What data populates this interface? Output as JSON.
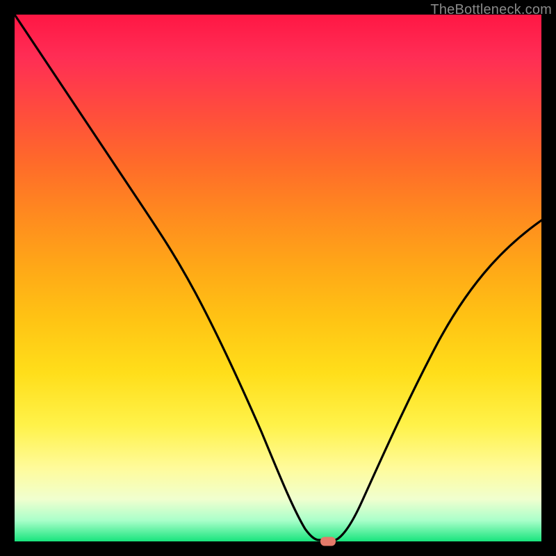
{
  "watermark": "TheBottleneck.com",
  "chart_data": {
    "type": "line",
    "title": "",
    "xlabel": "",
    "ylabel": "",
    "xlim": [
      0,
      100
    ],
    "ylim": [
      0,
      100
    ],
    "x": [
      0,
      8,
      16,
      24,
      29,
      34,
      39,
      44,
      48,
      52,
      55,
      57,
      59,
      61,
      64,
      68,
      73,
      80,
      88,
      96,
      100
    ],
    "values": [
      100,
      88,
      76,
      64,
      56,
      48,
      40,
      31,
      22,
      12,
      5,
      1,
      0.3,
      0.3,
      1,
      6,
      15,
      28,
      42,
      55,
      61
    ],
    "marker": {
      "x": 59.5,
      "y": 0
    },
    "gradient_stops": [
      {
        "pos": 0,
        "color": "#ff1744"
      },
      {
        "pos": 50,
        "color": "#ffc414"
      },
      {
        "pos": 86,
        "color": "#fffb9a"
      },
      {
        "pos": 100,
        "color": "#18e47d"
      }
    ]
  }
}
